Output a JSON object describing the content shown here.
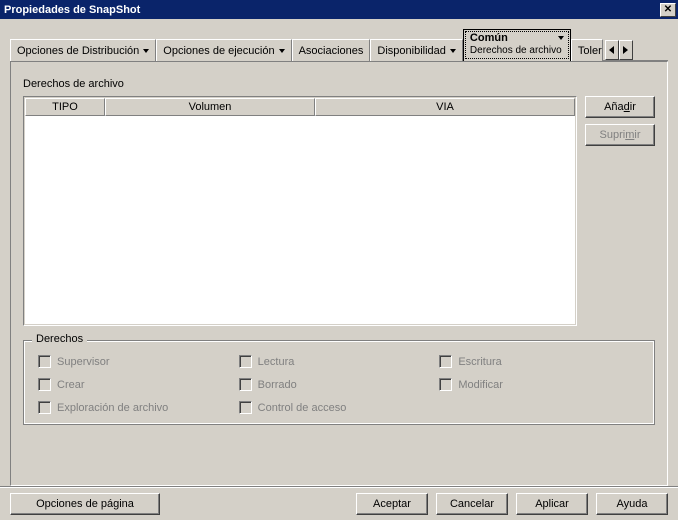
{
  "window": {
    "title": "Propiedades de SnapShot"
  },
  "tabs": {
    "t0": "Opciones de Distribución",
    "t1": "Opciones de ejecución",
    "t2": "Asociaciones",
    "t3": "Disponibilidad",
    "t4": "Común",
    "t4_sub": "Derechos de archivo",
    "t5": "Tolera"
  },
  "panel": {
    "section_label": "Derechos de archivo",
    "columns": {
      "tipo": "TIPO",
      "volumen": "Volumen",
      "via": "VIA"
    },
    "buttons": {
      "add": "Añadir",
      "add_ul": "d",
      "del_pre": "Supri",
      "del_ul": "m",
      "del_post": "ir"
    }
  },
  "rights": {
    "legend": "Derechos",
    "supervisor": "Supervisor",
    "lectura": "Lectura",
    "escritura": "Escritura",
    "crear": "Crear",
    "borrado": "Borrado",
    "modificar": "Modificar",
    "exploracion": "Exploración de archivo",
    "control": "Control de acceso"
  },
  "footer": {
    "page_options": "Opciones de página",
    "ok": "Aceptar",
    "cancel": "Cancelar",
    "apply": "Aplicar",
    "help": "Ayuda"
  }
}
